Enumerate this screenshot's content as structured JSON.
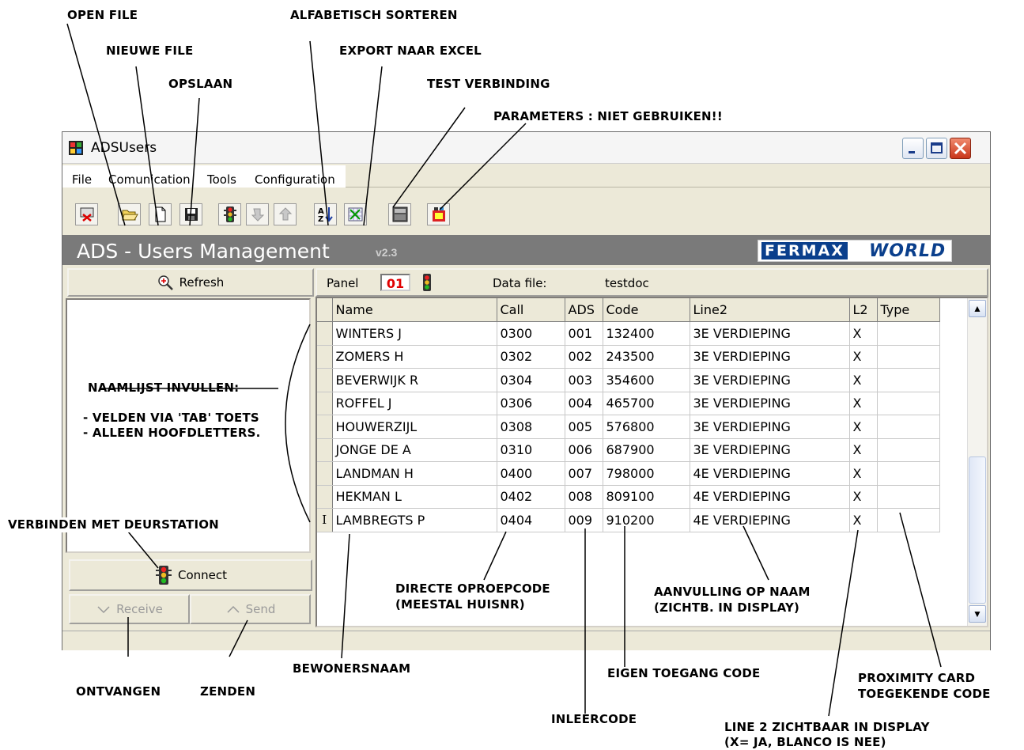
{
  "window": {
    "title": "ADSUsers",
    "controls": [
      "minimize",
      "maximize",
      "close"
    ]
  },
  "menu": [
    "File",
    "Comunication",
    "Tools",
    "Configuration"
  ],
  "toolbar": [
    "quit-icon",
    "open-folder-icon",
    "new-file-icon",
    "save-icon",
    "traffic-light-icon",
    "receive-arrow-icon",
    "send-arrow-icon",
    "sort-az-icon",
    "excel-export-icon",
    "test-connection-icon",
    "parameters-icon"
  ],
  "banner": {
    "title": "ADS - Users Management",
    "version": "v2.3",
    "logo_left": "FERMAX",
    "logo_right": "WORLD"
  },
  "left_panel": {
    "refresh": "Refresh",
    "connect": "Connect",
    "receive": "Receive",
    "send": "Send"
  },
  "info": {
    "panel_label": "Panel",
    "panel_value": "01",
    "data_file_label": "Data file:",
    "data_file_value": "testdoc"
  },
  "table": {
    "columns": [
      "Name",
      "Call",
      "ADS",
      "Code",
      "Line2",
      "L2",
      "Type"
    ],
    "rows": [
      [
        "WINTERS  J",
        "0300",
        "001",
        "132400",
        "3E VERDIEPING",
        "X",
        ""
      ],
      [
        "ZOMERS H",
        "0302",
        "002",
        "243500",
        "3E VERDIEPING",
        "X",
        ""
      ],
      [
        "BEVERWIJK R",
        "0304",
        "003",
        "354600",
        "3E VERDIEPING",
        "X",
        ""
      ],
      [
        "ROFFEL J",
        "0306",
        "004",
        "465700",
        "3E VERDIEPING",
        "X",
        ""
      ],
      [
        "HOUWERZIJL",
        "0308",
        "005",
        "576800",
        "3E VERDIEPING",
        "X",
        ""
      ],
      [
        "JONGE DE A",
        "0310",
        "006",
        "687900",
        "3E VERDIEPING",
        "X",
        ""
      ],
      [
        "LANDMAN H",
        "0400",
        "007",
        "798000",
        "4E VERDIEPING",
        "X",
        ""
      ],
      [
        "HEKMAN L",
        "0402",
        "008",
        "809100",
        "4E VERDIEPING",
        "X",
        ""
      ],
      [
        "LAMBREGTS P",
        "0404",
        "009",
        "910200",
        "4E VERDIEPING",
        "X",
        ""
      ]
    ]
  },
  "annotations": {
    "open_file": "OPEN FILE",
    "new_file": "NIEUWE FILE",
    "save": "OPSLAAN",
    "sort": "ALFABETISCH SORTEREN",
    "export": "EXPORT NAAR EXCEL",
    "test": "TEST VERBINDING",
    "params": "PARAMETERS : NIET GEBRUIKEN!!",
    "list_title": "NAAMLIJST INVULLEN:",
    "list_l1": "- VELDEN VIA 'TAB' TOETS",
    "list_l2": "- ALLEEN HOOFDLETTERS.",
    "connect": "VERBINDEN MET DEURSTATION",
    "receive": "ONTVANGEN",
    "send": "ZENDEN",
    "name": "BEWONERSNAAM",
    "call_1": "DIRECTE OPROEPCODE",
    "call_2": "(MEESTAL HUISNR)",
    "ads": "INLEERCODE",
    "code": "EIGEN TOEGANG CODE",
    "line2_1": "AANVULLING OP NAAM",
    "line2_2": "(ZICHTB. IN DISPLAY)",
    "l2_1": "LINE 2 ZICHTBAAR IN DISPLAY",
    "l2_2": "(X= JA,  BLANCO IS NEE)",
    "type_1": "PROXIMITY CARD",
    "type_2": "TOEGEKENDE CODE"
  },
  "colors": {
    "banner": "#7a7a7a",
    "panel_value": "#e00000",
    "logo_blue": "#0a3f8c"
  }
}
